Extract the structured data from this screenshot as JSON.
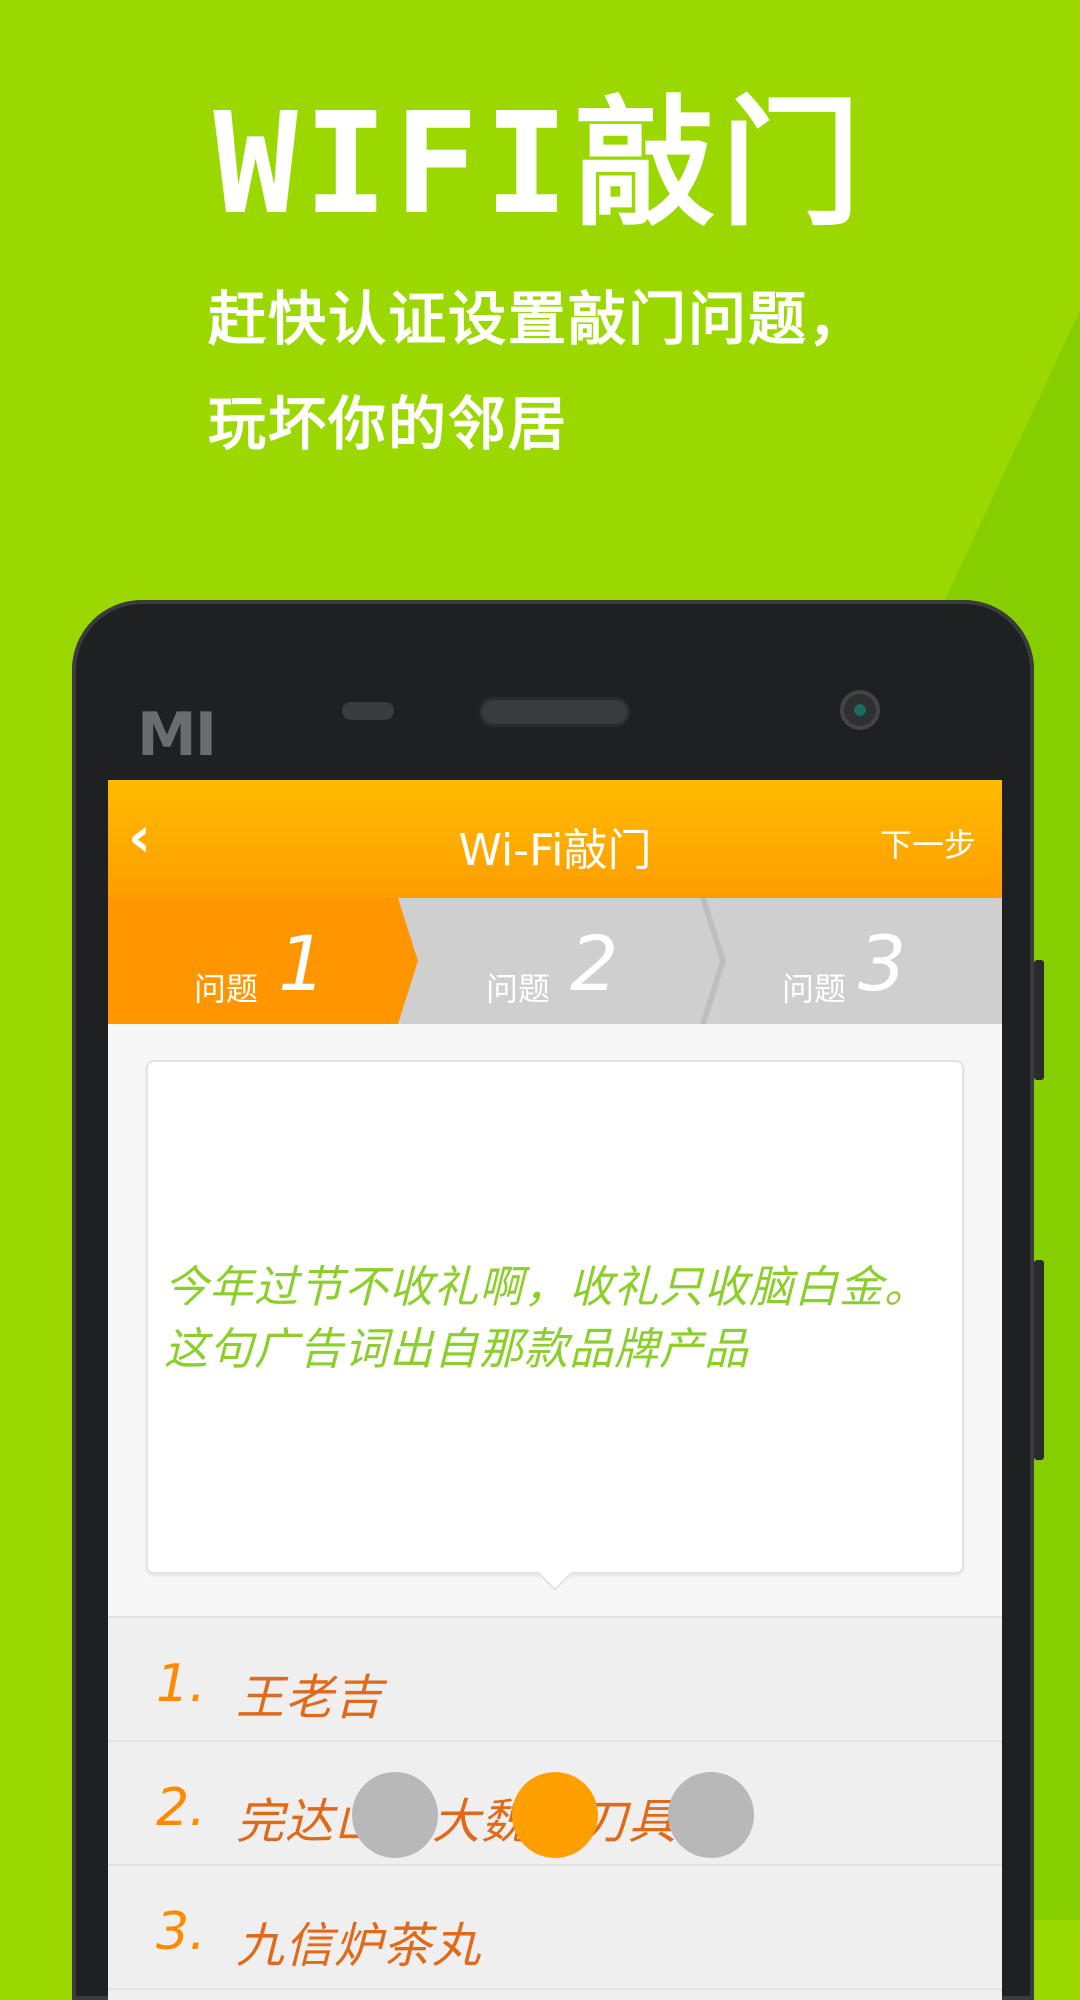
{
  "hero": {
    "title": "WIFI敲门",
    "subtitle_line1": "赶快认证设置敲门问题，",
    "subtitle_line2": "玩坏你的邻居"
  },
  "phone": {
    "brand_logo": "MI"
  },
  "appbar": {
    "back_icon": "chevron-left-icon",
    "title": "Wi-Fi敲门",
    "next_label": "下一步"
  },
  "steps": [
    {
      "label": "问题",
      "number": "1",
      "active": true
    },
    {
      "label": "问题",
      "number": "2",
      "active": false
    },
    {
      "label": "问题",
      "number": "3",
      "active": false
    }
  ],
  "question": {
    "text": "今年过节不收礼啊，收礼只收脑白金。这句广告词出自那款品牌产品"
  },
  "answers": [
    {
      "number": "1.",
      "text": "王老吉"
    },
    {
      "number": "2.",
      "text": "完达山和大魏家刀具"
    },
    {
      "number": "3.",
      "text": "九信炉茶丸"
    }
  ],
  "pager": {
    "count": 3,
    "active_index": 1
  },
  "colors": {
    "background_green": "#9bd800",
    "appbar_orange": "#ff9d00",
    "question_green": "#8ccf2a",
    "answer_orange": "#e0691a",
    "dot_active": "#ffa000",
    "dot_inactive": "#b8b8b8"
  }
}
